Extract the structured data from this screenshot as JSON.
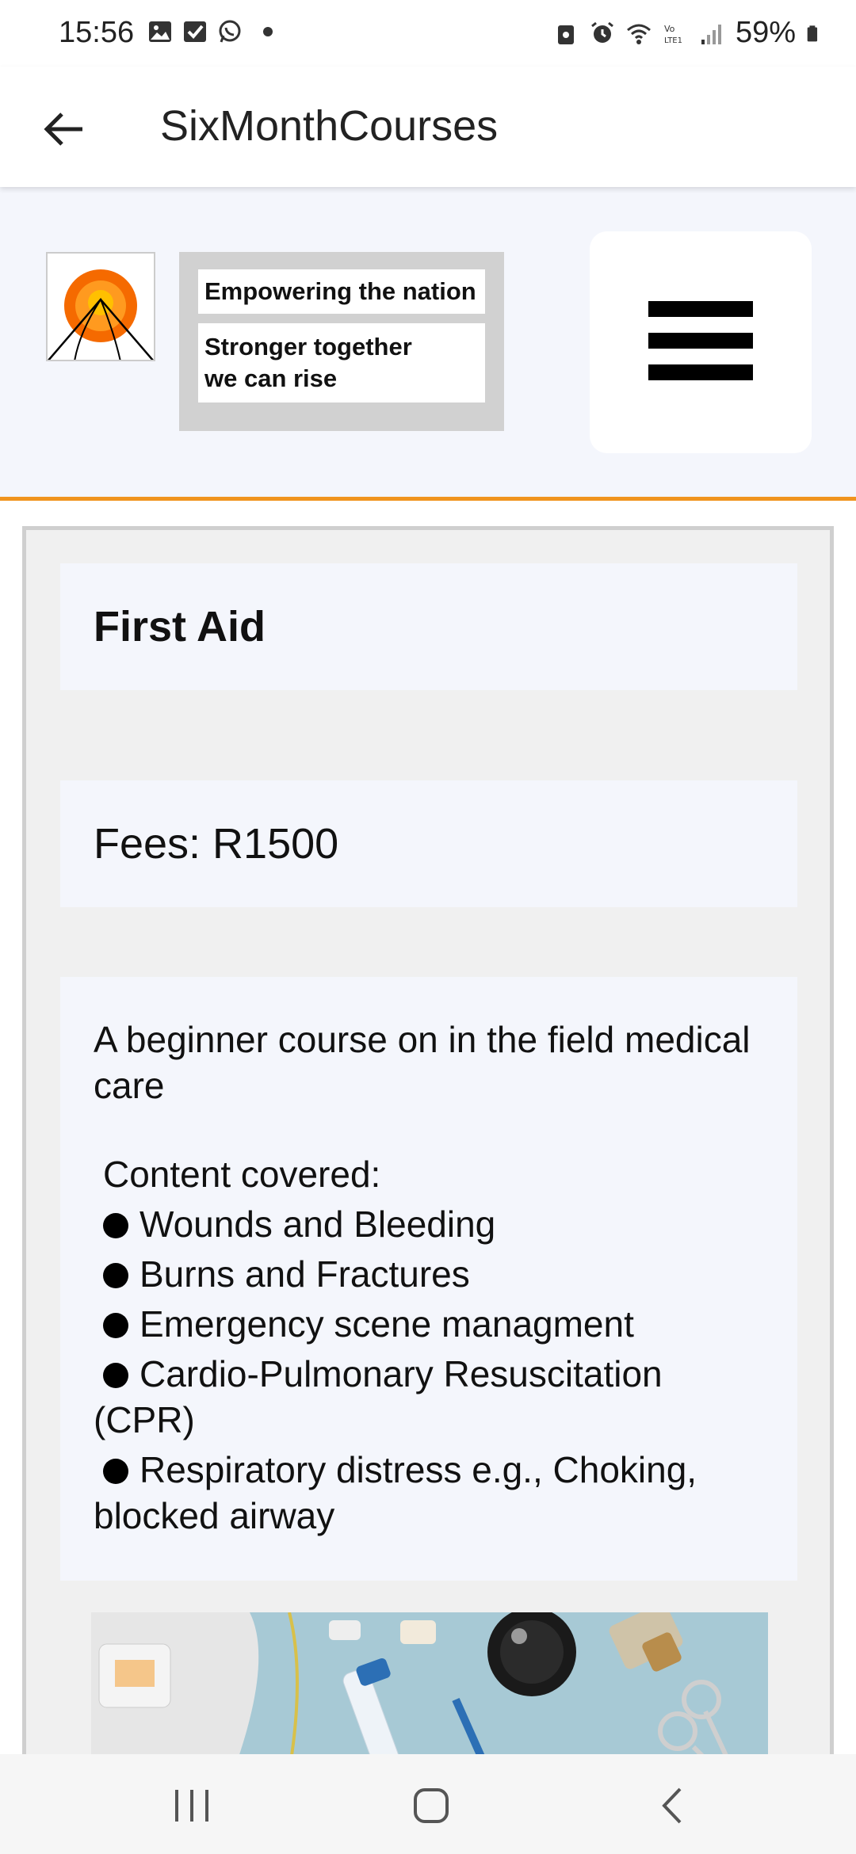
{
  "status_bar": {
    "time": "15:56",
    "battery": "59%",
    "left_icons": [
      "gallery-icon",
      "checkbox-icon",
      "whatsapp-icon",
      "dot-icon"
    ],
    "right_icons": [
      "lock-icon",
      "alarm-icon",
      "wifi-icon",
      "volte-icon",
      "signal-icon",
      "battery-icon"
    ]
  },
  "app_bar": {
    "title": "SixMonthCourses",
    "back_icon": "arrow-left-icon"
  },
  "header": {
    "slogan_1": "Empowering the nation",
    "slogan_2_line1": "Stronger together",
    "slogan_2_line2": "we can rise",
    "menu_icon": "hamburger-icon",
    "accent_color": "#f0941e"
  },
  "course": {
    "title": "First Aid",
    "fees": "Fees: R1500",
    "description": "A beginner course on in the field medical care",
    "content_heading": "Content covered:",
    "topics": [
      "Wounds and Bleeding",
      "Burns and Fractures",
      "Emergency scene managment",
      "Cardio-Pulmonary Resuscitation (CPR)",
      "Respiratory distress e.g., Choking, blocked airway"
    ]
  },
  "nav_bar": {
    "recents_icon": "recents-icon",
    "home_icon": "home-icon",
    "back_icon": "back-chevron-icon"
  }
}
